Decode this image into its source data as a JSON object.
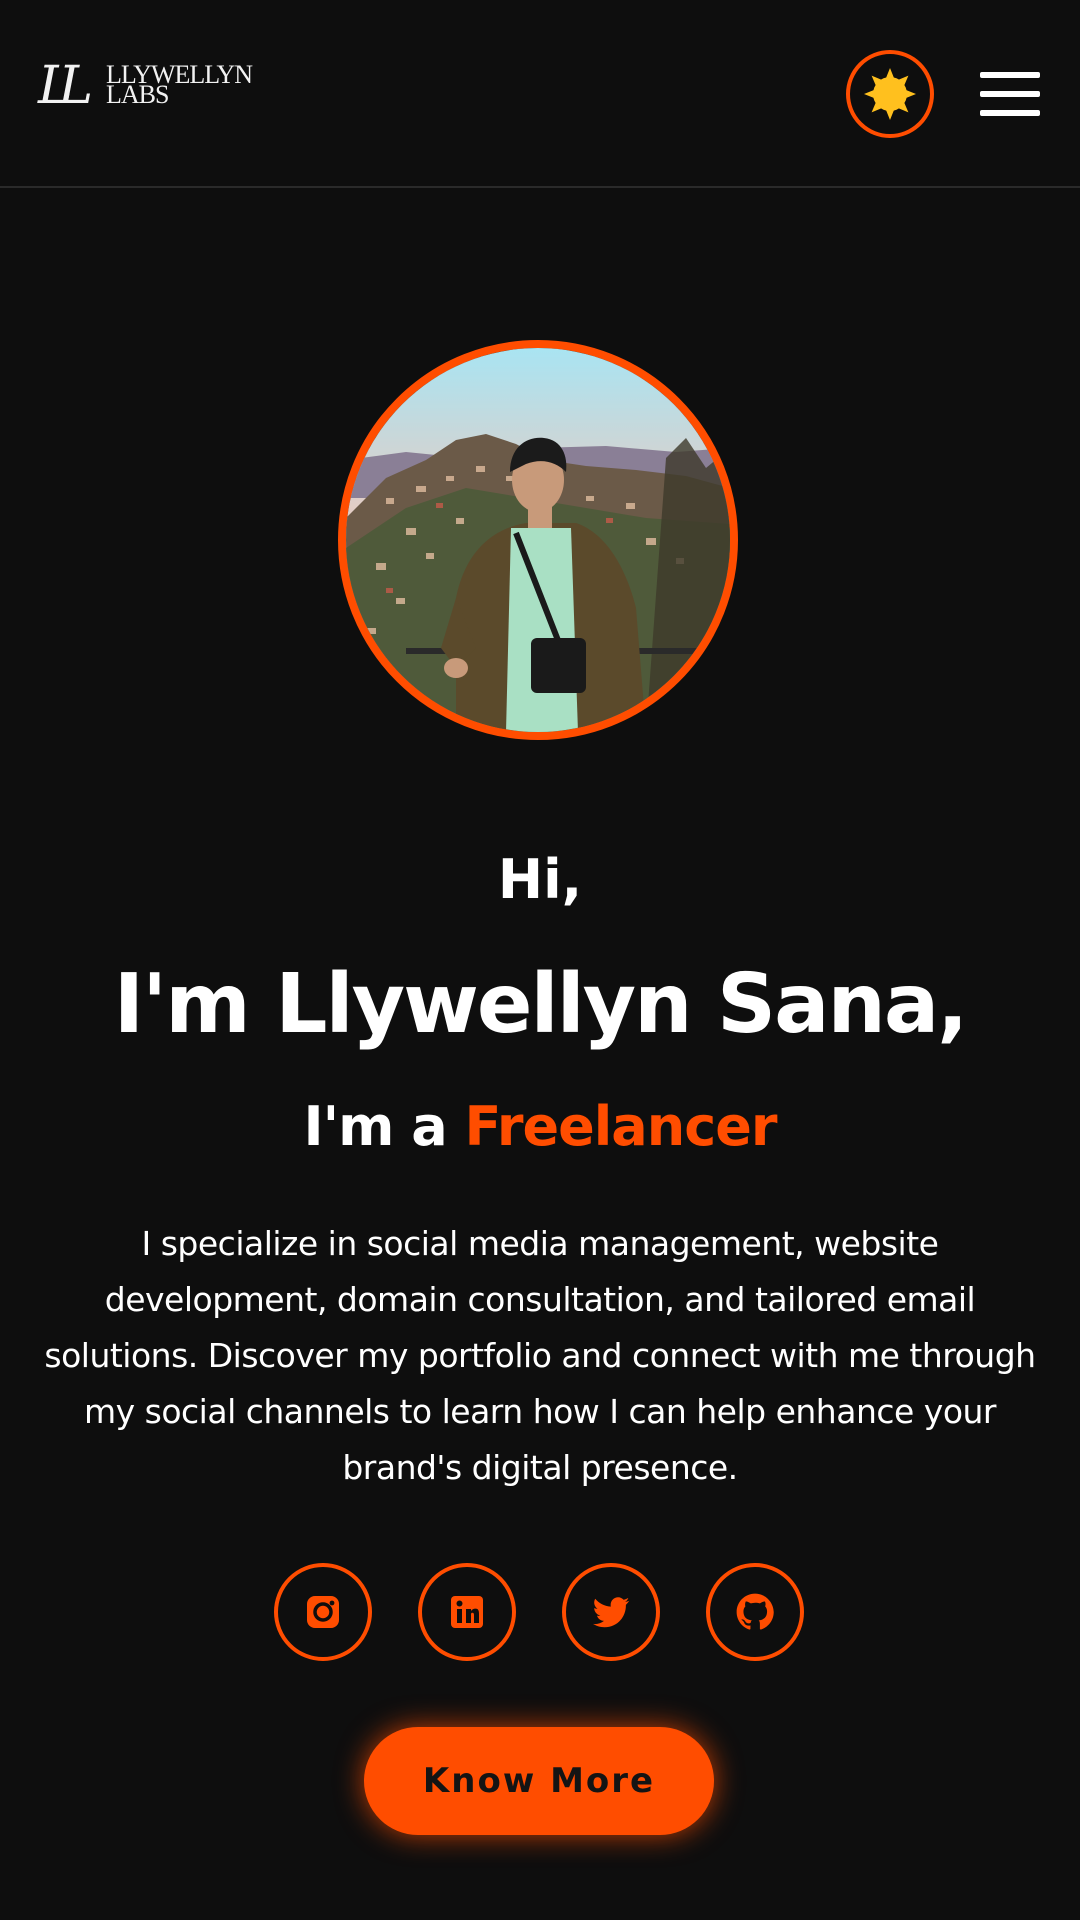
{
  "header": {
    "logo": {
      "mark": "LL",
      "line1": "LLYWELLYN",
      "line2": "LABS"
    },
    "theme_toggle_icon": "sun-icon",
    "menu_icon": "hamburger-menu-icon"
  },
  "profile": {
    "avatar_description": "profile-photo"
  },
  "hero": {
    "greeting": "Hi,",
    "name": "I'm Llywellyn Sana,",
    "role_prefix": "I'm a",
    "role_highlight": "Freelancer",
    "bio": "I specialize in social media management, website development, domain consultation, and tailored email solutions. Discover my portfolio and connect with me through my social channels to learn how I can help enhance your brand's digital presence."
  },
  "socials": [
    {
      "icon": "instagram-icon"
    },
    {
      "icon": "linkedin-icon"
    },
    {
      "icon": "twitter-icon"
    },
    {
      "icon": "github-icon"
    }
  ],
  "cta": {
    "label": "Know More"
  },
  "colors": {
    "background": "#0e0e0e",
    "accent": "#ff4d00",
    "sun": "#ffc01e",
    "text": "#ffffff"
  }
}
